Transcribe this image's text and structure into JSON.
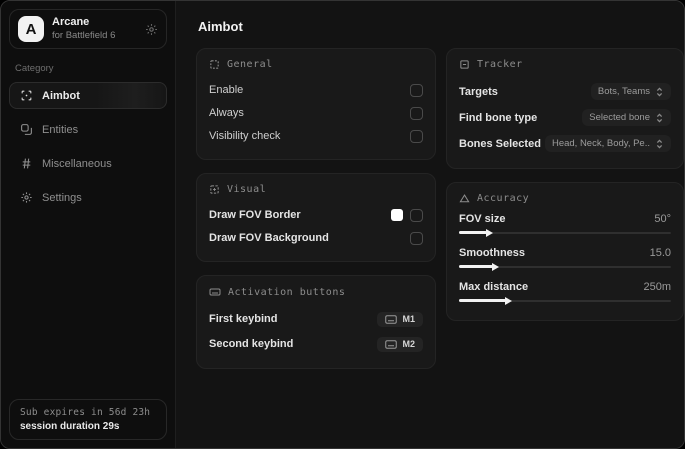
{
  "app": {
    "logo_letter": "A",
    "name": "Arcane",
    "subtitle": "for Battlefield 6"
  },
  "sidebar": {
    "category_label": "Category",
    "items": [
      {
        "label": "Aimbot",
        "icon": "crosshair-icon",
        "selected": true
      },
      {
        "label": "Entities",
        "icon": "entities-icon",
        "selected": false
      },
      {
        "label": "Miscellaneous",
        "icon": "hash-icon",
        "selected": false
      },
      {
        "label": "Settings",
        "icon": "gear-icon",
        "selected": false
      }
    ],
    "subscription": {
      "expires": "Sub expires in 56d 23h",
      "session": "session duration 29s"
    }
  },
  "main": {
    "title": "Aimbot",
    "general": {
      "title": "General",
      "icon": "dashed-square-icon",
      "rows": [
        {
          "label": "Enable",
          "checked": false
        },
        {
          "label": "Always",
          "checked": false
        },
        {
          "label": "Visibility check",
          "checked": false
        }
      ]
    },
    "visual": {
      "title": "Visual",
      "icon": "plus-square-icon",
      "rows": [
        {
          "label": "Draw FOV Border",
          "checked": false,
          "swatch_color": "#ffffff"
        },
        {
          "label": "Draw FOV Background",
          "checked": false
        }
      ]
    },
    "activation": {
      "title": "Activation buttons",
      "icon": "keyboard-icon",
      "rows": [
        {
          "label": "First keybind",
          "key": "M1"
        },
        {
          "label": "Second keybind",
          "key": "M2"
        }
      ]
    },
    "tracker": {
      "title": "Tracker",
      "icon": "minus-square-icon",
      "rows": [
        {
          "label": "Targets",
          "value": "Bots, Teams"
        },
        {
          "label": "Find bone type",
          "value": "Selected bone"
        },
        {
          "label": "Bones Selected",
          "value": "Head, Neck, Body, Pe.."
        }
      ]
    },
    "accuracy": {
      "title": "Accuracy",
      "icon": "triangle-icon",
      "rows": [
        {
          "label": "FOV size",
          "value": "50°",
          "fill_pct": 13
        },
        {
          "label": "Smoothness",
          "value": "15.0",
          "fill_pct": 16
        },
        {
          "label": "Max distance",
          "value": "250m",
          "fill_pct": 22
        }
      ]
    }
  },
  "colors": {
    "swatch_white": "#ffffff",
    "accent_fill": "#f2f2f2"
  }
}
